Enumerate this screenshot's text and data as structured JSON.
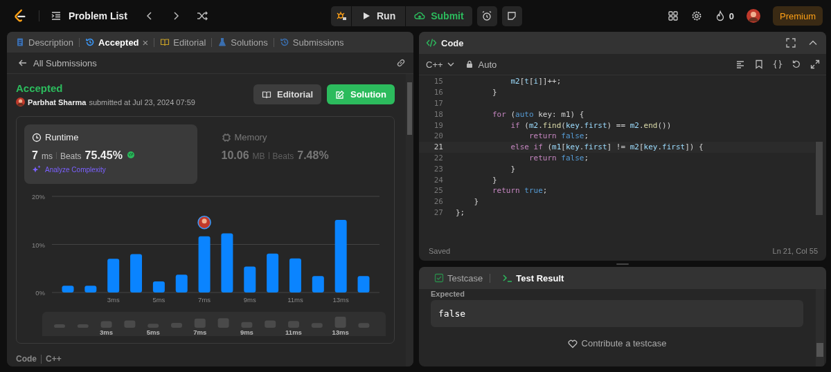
{
  "topbar": {
    "title": "Problem List",
    "run": "Run",
    "submit": "Submit",
    "streak": "0",
    "premium": "Premium"
  },
  "left_panel": {
    "tabs": [
      {
        "label": "Description",
        "selected": false,
        "closable": false
      },
      {
        "label": "Accepted",
        "selected": true,
        "closable": true
      },
      {
        "label": "Editorial",
        "selected": false,
        "closable": false
      },
      {
        "label": "Solutions",
        "selected": false,
        "closable": false
      },
      {
        "label": "Submissions",
        "selected": false,
        "closable": false
      }
    ],
    "close_glyph": "×",
    "back": "All Submissions",
    "status": "Accepted",
    "author": "Parbhat Sharma",
    "submitted": "submitted at Jul 23, 2024 07:59",
    "buttons": [
      {
        "label": "Editorial",
        "kind": "secondary"
      },
      {
        "label": "Solution",
        "kind": "primary"
      }
    ],
    "stats": [
      {
        "title": "Runtime",
        "selected": true,
        "value": "7",
        "unit": "ms",
        "beats_label": "Beats",
        "beats": "75.45%",
        "link": "Analyze Complexity"
      },
      {
        "title": "Memory",
        "selected": false,
        "value": "10.06",
        "unit": "MB",
        "beats_label": "Beats",
        "beats": "7.48%"
      }
    ],
    "chart_data": {
      "type": "bar",
      "x": [
        1,
        2,
        3,
        4,
        5,
        6,
        7,
        8,
        9,
        10,
        11,
        12,
        13,
        14
      ],
      "series": [
        {
          "color": "#0a84ff",
          "values": [
            1.4,
            1.4,
            7.0,
            8.0,
            2.3,
            3.7,
            11.7,
            12.3,
            5.4,
            8.1,
            7.1,
            3.4,
            15.1,
            3.4
          ]
        }
      ],
      "xlim": [
        0.3,
        14.7
      ],
      "ylim": [
        0,
        20
      ],
      "yticks": [
        {
          "value": 0,
          "label": "0%"
        },
        {
          "value": 10,
          "label": "10%"
        },
        {
          "value": 20,
          "label": "20%"
        }
      ],
      "xticks": [
        {
          "value": 3,
          "label": "3ms"
        },
        {
          "value": 5,
          "label": "5ms"
        },
        {
          "value": 7,
          "label": "7ms"
        },
        {
          "value": 9,
          "label": "9ms"
        },
        {
          "value": 11,
          "label": "11ms"
        },
        {
          "value": 13,
          "label": "13ms"
        }
      ]
    },
    "overview_labels": [
      "3ms",
      "5ms",
      "7ms",
      "9ms",
      "11ms",
      "13ms"
    ],
    "footer": [
      "Code",
      "C++"
    ]
  },
  "code_panel": {
    "title": "Code",
    "language": "C++",
    "mode": "Auto",
    "lines": [
      {
        "number": "15",
        "current": false,
        "tokens": [
          {
            "text": "            m2",
            "kind": "var"
          },
          {
            "text": "[",
            "kind": "p"
          },
          {
            "text": "t",
            "kind": "var"
          },
          {
            "text": "[",
            "kind": "p"
          },
          {
            "text": "i",
            "kind": "var"
          },
          {
            "text": "]]++;",
            "kind": "p"
          }
        ]
      },
      {
        "number": "16",
        "current": false,
        "tokens": [
          {
            "text": "        }",
            "kind": "p"
          }
        ]
      },
      {
        "number": "17",
        "current": false
      },
      {
        "number": "18",
        "current": false,
        "tokens": [
          {
            "text": "        for",
            "kind": "kw"
          },
          {
            "text": " (",
            "kind": "p"
          },
          {
            "text": "auto",
            "kind": "const"
          },
          {
            "text": " key: m1) {",
            "kind": "p"
          }
        ]
      },
      {
        "number": "19",
        "current": false,
        "tokens": [
          {
            "text": "            if",
            "kind": "kw"
          },
          {
            "text": " (",
            "kind": "p"
          },
          {
            "text": "m2",
            "kind": "var"
          },
          {
            "text": ".",
            "kind": "p"
          },
          {
            "text": "find",
            "kind": "fn"
          },
          {
            "text": "(",
            "kind": "p"
          },
          {
            "text": "key",
            "kind": "var"
          },
          {
            "text": ".",
            "kind": "p"
          },
          {
            "text": "first",
            "kind": "var"
          },
          {
            "text": ") == ",
            "kind": "p"
          },
          {
            "text": "m2",
            "kind": "var"
          },
          {
            "text": ".",
            "kind": "p"
          },
          {
            "text": "end",
            "kind": "fn"
          },
          {
            "text": "())",
            "kind": "p"
          }
        ]
      },
      {
        "number": "20",
        "current": false,
        "tokens": [
          {
            "text": "                return ",
            "kind": "kw"
          },
          {
            "text": "false",
            "kind": "const"
          },
          {
            "text": ";",
            "kind": "p"
          }
        ]
      },
      {
        "number": "21",
        "current": true,
        "tokens": [
          {
            "text": "            else if",
            "kind": "kw"
          },
          {
            "text": " (",
            "kind": "p"
          },
          {
            "text": "m1",
            "kind": "var"
          },
          {
            "text": "[",
            "kind": "p"
          },
          {
            "text": "key",
            "kind": "var"
          },
          {
            "text": ".",
            "kind": "p"
          },
          {
            "text": "first",
            "kind": "var"
          },
          {
            "text": "] != ",
            "kind": "p"
          },
          {
            "text": "m2",
            "kind": "var"
          },
          {
            "text": "[",
            "kind": "p"
          },
          {
            "text": "key",
            "kind": "var"
          },
          {
            "text": ".",
            "kind": "p"
          },
          {
            "text": "first",
            "kind": "var"
          },
          {
            "text": "]) {",
            "kind": "p"
          }
        ]
      },
      {
        "number": "22",
        "current": false,
        "tokens": [
          {
            "text": "                return ",
            "kind": "kw"
          },
          {
            "text": "false",
            "kind": "const"
          },
          {
            "text": ";",
            "kind": "p"
          }
        ]
      },
      {
        "number": "23",
        "current": false,
        "tokens": [
          {
            "text": "            }",
            "kind": "p"
          }
        ]
      },
      {
        "number": "24",
        "current": false,
        "tokens": [
          {
            "text": "        }",
            "kind": "p"
          }
        ]
      },
      {
        "number": "25",
        "current": false,
        "tokens": [
          {
            "text": "        return ",
            "kind": "kw"
          },
          {
            "text": "true",
            "kind": "const"
          },
          {
            "text": ";",
            "kind": "p"
          }
        ]
      },
      {
        "number": "26",
        "current": false,
        "tokens": [
          {
            "text": "    }",
            "kind": "p"
          }
        ]
      },
      {
        "number": "27",
        "current": false,
        "tokens": [
          {
            "text": "};",
            "kind": "p"
          }
        ]
      }
    ],
    "saved": "Saved",
    "cursor": "Ln 21, Col 55"
  },
  "test_panel": {
    "tabs": [
      {
        "label": "Testcase",
        "selected": false
      },
      {
        "label": "Test Result",
        "selected": true
      }
    ],
    "label": "Expected",
    "value": "false",
    "contribute": "Contribute a testcase"
  }
}
